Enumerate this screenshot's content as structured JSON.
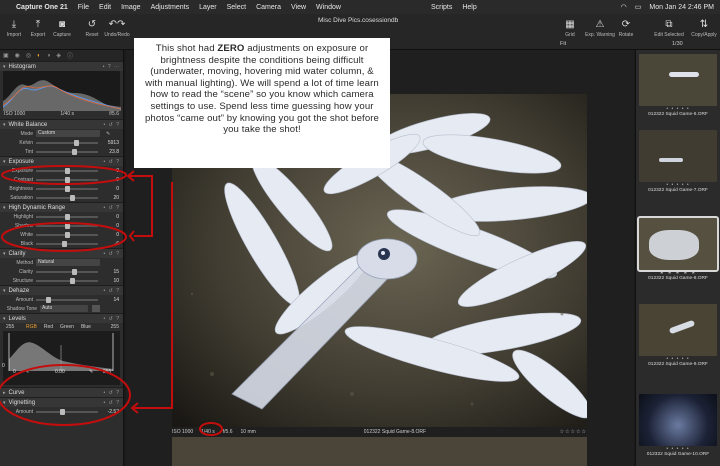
{
  "menubar": {
    "app_name": "Capture One 21",
    "items": [
      "File",
      "Edit",
      "Image",
      "Adjustments",
      "Layer",
      "Select",
      "Camera",
      "View",
      "Window"
    ],
    "right_items": [
      "Scripts",
      "Help"
    ],
    "clock": "Mon Jan 24  2:46 PM"
  },
  "toolbar": {
    "import": "Import",
    "export": "Export",
    "capture": "Capture",
    "reset": "Reset",
    "undo_redo": "Undo/Redo",
    "grid": "Grid",
    "exp_warning": "Exp. Warning",
    "rotate": "Rotate",
    "edit_selected": "Edit Selected",
    "copy_apply": "Copy/Apply",
    "doc_title": "Misc Dive Pics.cosessiondb",
    "fit": "Fit",
    "shutter_top": "1/30"
  },
  "left": {
    "histogram": {
      "title": "Histogram",
      "iso": "ISO 1000",
      "shutter": "1/40 s",
      "aperture": "f/5.6"
    },
    "white_balance": {
      "title": "White Balance",
      "mode_label": "Mode",
      "mode_value": "Custom",
      "kelvin_label": "Kelvin",
      "kelvin_value": "5913",
      "tint_label": "Tint",
      "tint_value": "23.8"
    },
    "exposure": {
      "title": "Exposure",
      "exposure_label": "Exposure",
      "exposure_value": "0",
      "contrast_label": "Contrast",
      "contrast_value": "0",
      "brightness_label": "Brightness",
      "brightness_value": "0",
      "saturation_label": "Saturation",
      "saturation_value": "20"
    },
    "hdr": {
      "title": "High Dynamic Range",
      "highlight_label": "Highlight",
      "highlight_value": "0",
      "shadow_label": "Shadow",
      "shadow_value": "0",
      "white_label": "White",
      "white_value": "0",
      "black_label": "Black",
      "black_value": "-6"
    },
    "clarity": {
      "title": "Clarity",
      "method_label": "Method",
      "method_value": "Natural",
      "clarity_label": "Clarity",
      "clarity_value": "15",
      "structure_label": "Structure",
      "structure_value": "10"
    },
    "dehaze": {
      "title": "Dehaze",
      "amount_label": "Amount",
      "amount_value": "14",
      "shadow_tone_label": "Shadow Tone",
      "shadow_tone_value": "Auto"
    },
    "levels": {
      "title": "Levels",
      "tabs": [
        "RGB",
        "Red",
        "Green",
        "Blue"
      ],
      "top_left": "255",
      "top_right": "255",
      "in_black": "0",
      "mid": "0.00",
      "in_white": "255",
      "out_black": "0"
    },
    "curve": {
      "title": "Curve"
    },
    "vignetting": {
      "title": "Vignetting",
      "amount_label": "Amount",
      "amount_value": "-2.52"
    }
  },
  "viewer": {
    "iso": "ISO 1000",
    "shutter": "1/40 s",
    "aperture": "f/5.6",
    "focal": "10 mm",
    "filename": "012322 Squid Game-8.ORF",
    "stars": "☆☆☆☆☆"
  },
  "browser": {
    "thumbs": [
      {
        "caption": "012322 Squid Game-6.ORF",
        "stars": "• • • • •"
      },
      {
        "caption": "012322 Squid Game-7.ORF",
        "stars": "• • • • •"
      },
      {
        "caption": "012322 Squid Game-8.ORF",
        "stars": "★ ★ ★ ★ ★"
      },
      {
        "caption": "012322 Squid Game-9.ORF",
        "stars": "• • • • •"
      },
      {
        "caption": "012322 Squid Game-10.ORF",
        "stars": "• • • • •"
      }
    ]
  },
  "annotation": {
    "lead": "This shot had ",
    "bold": "ZERO",
    "body": " adjustments on exposure or brightness despite the conditions being difficult (underwater, moving, hovering mid water column, & with manual lighting). We will spend a lot of time learn how to read the “scene” so you know which camera settings to use. Spend less time guessing how your photos “came out” by knowing you got the shot before you take the shot!"
  },
  "colors": {
    "annotation_red": "#c40d0d",
    "accent": "#f0a030"
  }
}
